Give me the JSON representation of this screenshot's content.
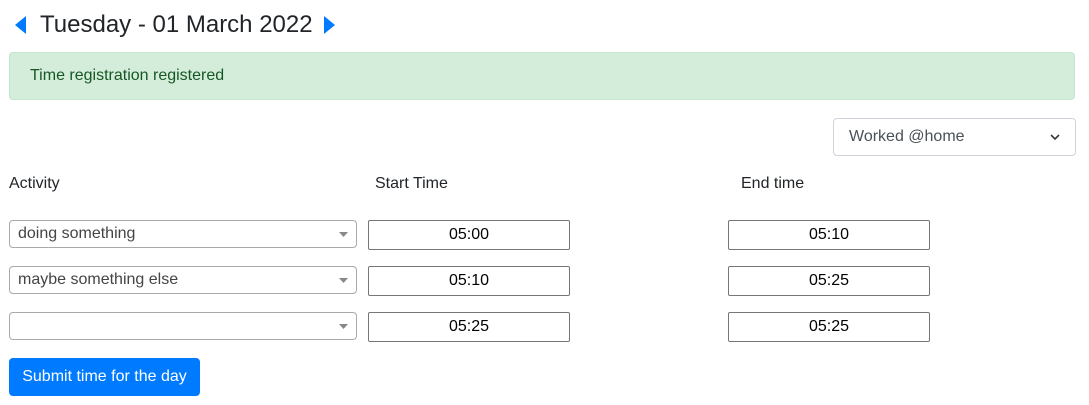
{
  "header": {
    "date_title": "Tuesday - 01 March 2022",
    "prev_icon": "caret-left-icon",
    "next_icon": "caret-right-icon"
  },
  "alert": {
    "message": "Time registration registered",
    "color": "#155724",
    "background": "#d4edda"
  },
  "location": {
    "selected": "Worked @home"
  },
  "columns": {
    "activity": "Activity",
    "start": "Start Time",
    "end": "End time"
  },
  "rows": [
    {
      "activity": "doing something",
      "start": "05:00",
      "end": "05:10"
    },
    {
      "activity": "maybe something else",
      "start": "05:10",
      "end": "05:25"
    },
    {
      "activity": "",
      "start": "05:25",
      "end": "05:25"
    }
  ],
  "submit": {
    "label": "Submit time for the day",
    "color": "#007bff"
  }
}
